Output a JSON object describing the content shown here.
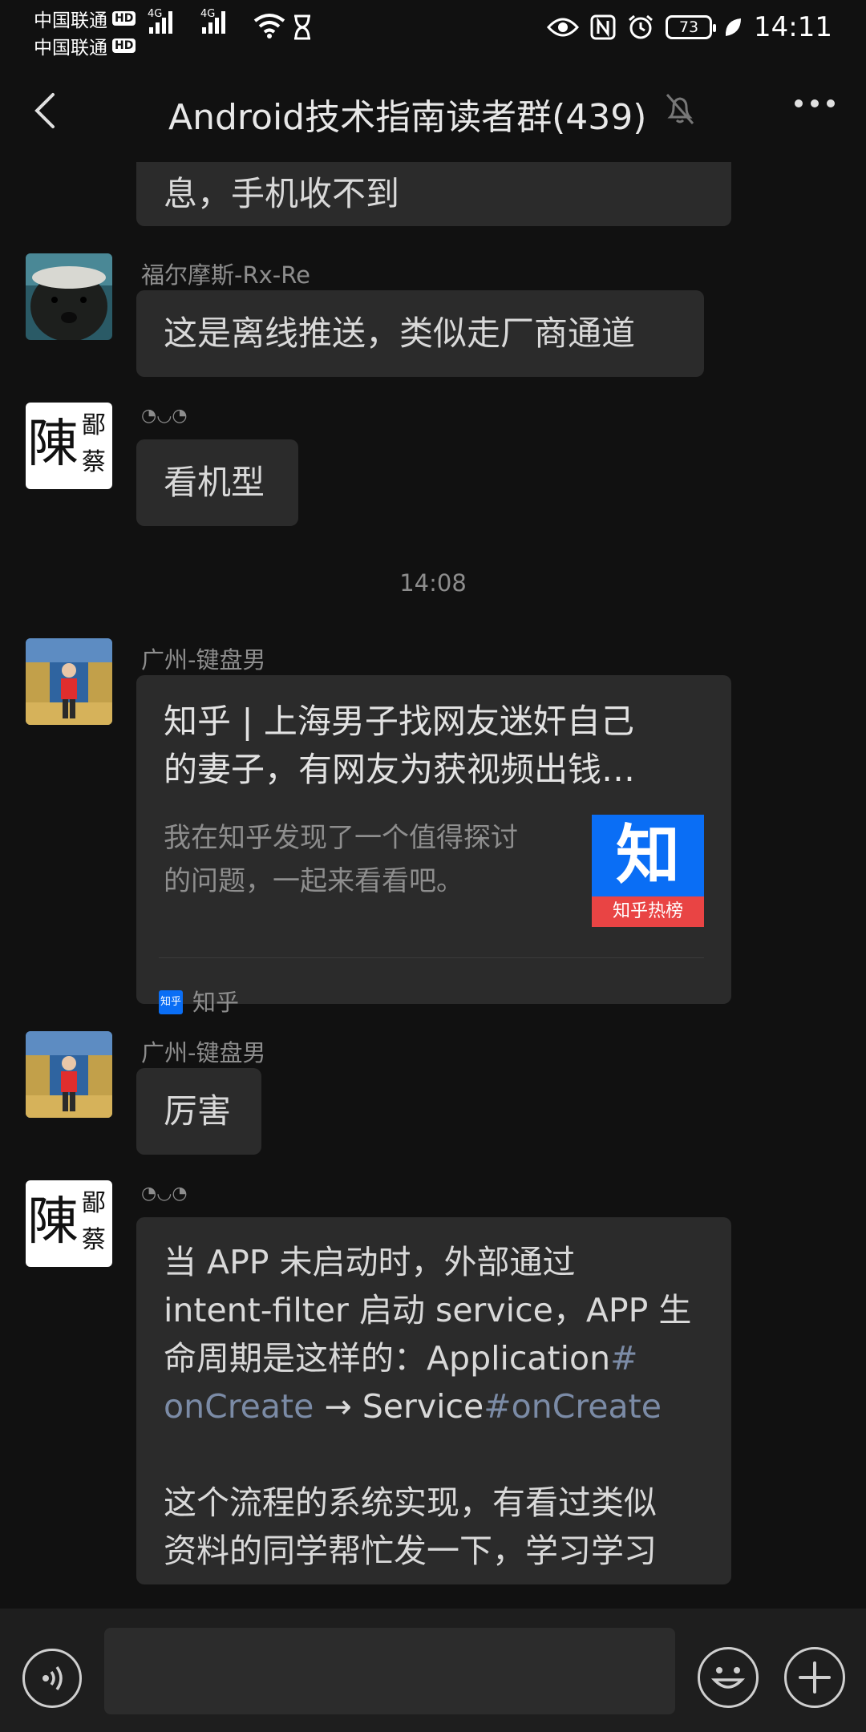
{
  "status_bar": {
    "carrier1": "中国联通",
    "carrier2": "中国联通",
    "hd_badge": "HD",
    "network1": "4G",
    "network2": "4G",
    "battery": "73",
    "time": "14:11"
  },
  "title_bar": {
    "title": "Android技术指南读者群(439)",
    "back_icon": "chevron-left-icon",
    "mute_icon": "bell-off-icon",
    "more_icon": "more-horizontal-icon"
  },
  "messages": [
    {
      "text": "息，手机收不到"
    },
    {
      "sender": "福尔摩斯-Rx-Re",
      "text": "这是离线推送，类似走厂商通道"
    },
    {
      "sender": "◔◡◔",
      "text": "看机型"
    },
    {
      "time": "14:08"
    },
    {
      "sender": "广州-键盘男",
      "card": {
        "title_line1": "知乎 | 上海男子找网友迷奸自己",
        "title_line2": "的妻子，有网友为获视频出钱…",
        "desc_line1": "我在知乎发现了一个值得探讨",
        "desc_line2": "的问题，一起来看看吧。",
        "thumb_char": "知",
        "thumb_label": "知乎热榜",
        "source_icon_text": "知乎",
        "source": "知乎"
      }
    },
    {
      "sender": "广州-键盘男",
      "text": "厉害"
    },
    {
      "sender": "◔◡◔",
      "long": {
        "l1": "当 APP 未启动时，外部通过",
        "l2": "intent-filter 启动 service，APP 生",
        "l3a": "命周期是这样的：Application",
        "l3b": "#",
        "l4a": "onCreate",
        "l4b": " → Service",
        "l4c": "#onCreate",
        "l5": "这个流程的系统实现，有看过类似",
        "l6": "资料的同学帮忙发一下，学习学习"
      }
    }
  ],
  "avatars": {
    "seal_chars": "陳",
    "seal_small": "鄙蔡"
  },
  "input_bar": {
    "voice_icon": "voice-icon",
    "emoji_icon": "emoji-icon",
    "plus_icon": "plus-icon"
  },
  "colors": {
    "background": "#111111",
    "bubble": "#2b2b2b",
    "link": "#7b8ba6",
    "zhihu_blue": "#0a6ef5"
  }
}
